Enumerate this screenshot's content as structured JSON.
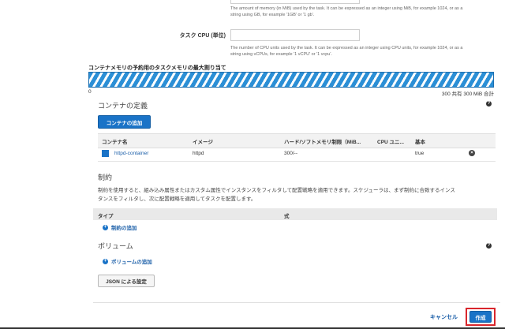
{
  "memory_help": [
    "The amount of memory (in MiB) used by the task. It can be expressed as an integer using MiB, for example 1024, or as a",
    "string using GB, for example '1GB' or '1 gb'."
  ],
  "task_cpu": {
    "label": "タスク CPU (単位)",
    "value": "",
    "help": [
      "The number of CPU units used by the task. It can be expressed as an integer using CPU units, for example 1024, or as a",
      "string using vCPUs, for example '1 vCPU' or '1 vcpu'."
    ]
  },
  "memory_allocation": {
    "label": "コンテナメモリの予約用のタスクメモリの最大割り当て",
    "min_label": "0",
    "summary": "300 共有 300 MiB 合計",
    "fill_fraction": 1.0
  },
  "container_definitions": {
    "title": "コンテナの定義",
    "add_button": "コンテナの追加",
    "headers": [
      "コンテナ名",
      "イメージ",
      "ハード/ソフトメモリ制限（MiB...",
      "CPU ユニ...",
      "基本"
    ],
    "rows": [
      {
        "name": "httpd-container",
        "image": "httpd",
        "memory": "300/--",
        "cpu": "",
        "essential": "true"
      }
    ]
  },
  "constraints": {
    "title": "制約",
    "description": [
      "制約を使用すると、組み込み属性またはカスタム属性でインスタンスをフィルタして配置戦略を適用できます。スケジューラは、まず制約に合致するインス",
      "タンスをフィルタし、次に配置戦略を適用してタスクを配置します。"
    ],
    "headers": [
      "タイプ",
      "式"
    ],
    "add_link": "制約の追加"
  },
  "volumes": {
    "title": "ボリューム",
    "add_link": "ボリュームの追加"
  },
  "json_button": "JSON による設定",
  "footer": {
    "cancel": "キャンセル",
    "create": "作成"
  },
  "colors": {
    "primary": "#1a73c7",
    "bar_stripe": "#2b8fd6",
    "highlight": "#d9262c"
  }
}
